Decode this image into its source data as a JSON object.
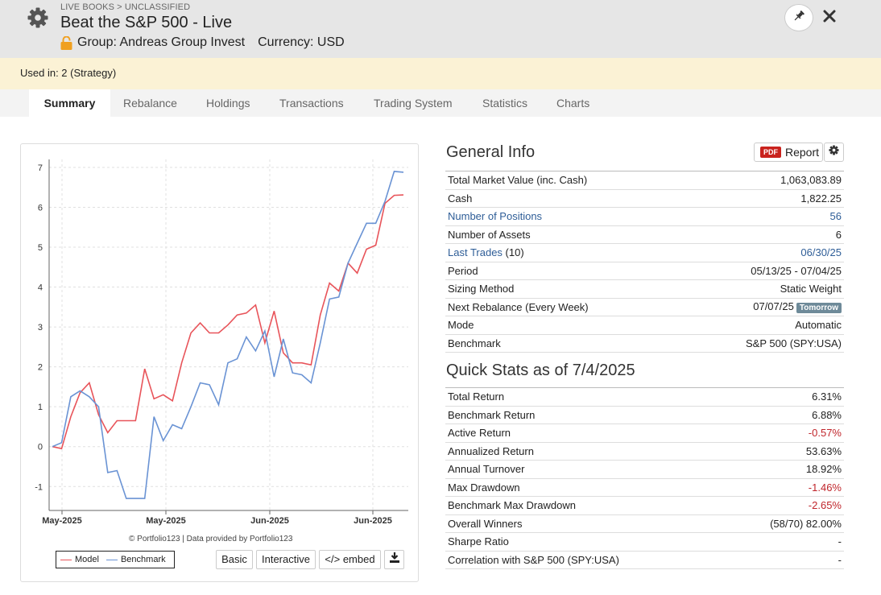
{
  "header": {
    "breadcrumb": "LIVE BOOKS > UNCLASSIFIED",
    "title": "Beat the S&P 500 - Live",
    "group": "Group: Andreas Group Invest",
    "currency": "Currency: USD",
    "settings_icon": "gear-icon",
    "pin_icon": "pin-icon",
    "close_icon": "close-icon"
  },
  "used_in": "Used in: 2 (Strategy)",
  "tabs": [
    {
      "label": "Summary",
      "active": true
    },
    {
      "label": "Rebalance"
    },
    {
      "label": "Holdings"
    },
    {
      "label": "Transactions"
    },
    {
      "label": "Trading System"
    },
    {
      "label": "Statistics"
    },
    {
      "label": "Charts"
    }
  ],
  "colors": {
    "model": "#e8545a",
    "benchmark": "#6a93d4",
    "link": "#2e5d97",
    "negative": "#c0252b"
  },
  "chart": {
    "credit": "© Portfolio123 | Data provided by Portfolio123",
    "buttons": {
      "basic": "Basic",
      "interactive": "Interactive",
      "embed": "</> embed"
    },
    "download_icon": "download-icon"
  },
  "chart_data": {
    "type": "line",
    "xlabel": "",
    "ylabel": "",
    "ylim": [
      -1.6,
      7.2
    ],
    "y_ticks": [
      -1,
      0,
      1,
      2,
      3,
      4,
      5,
      6,
      7
    ],
    "x_tick_labels": [
      "May-2025",
      "May-2025",
      "Jun-2025",
      "Jun-2025"
    ],
    "grid": true,
    "legend_position": "bottom-left",
    "series": [
      {
        "name": "Model",
        "color": "#e8545a",
        "values": [
          0,
          -0.05,
          0.75,
          1.35,
          1.6,
          0.8,
          0.35,
          0.65,
          0.65,
          0.65,
          1.95,
          1.2,
          1.3,
          1.15,
          2.1,
          2.85,
          3.1,
          2.85,
          2.85,
          3.05,
          3.3,
          3.35,
          3.55,
          2.6,
          3.4,
          2.35,
          2.1,
          2.1,
          2.05,
          3.3,
          4.1,
          3.9,
          4.6,
          4.35,
          4.95,
          5.05,
          6.1,
          6.3,
          6.31
        ]
      },
      {
        "name": "Benchmark",
        "color": "#6a93d4",
        "values": [
          0,
          0.1,
          1.25,
          1.4,
          1.25,
          1.0,
          -0.65,
          -0.6,
          -1.3,
          -1.3,
          -1.3,
          0.75,
          0.15,
          0.55,
          0.45,
          1.0,
          1.6,
          1.55,
          1.05,
          2.1,
          2.2,
          2.75,
          2.4,
          2.9,
          1.75,
          2.7,
          1.85,
          1.8,
          1.6,
          2.6,
          3.7,
          3.75,
          4.6,
          5.1,
          5.6,
          5.6,
          6.15,
          6.9,
          6.88
        ]
      }
    ]
  },
  "general_info": {
    "title": "General Info",
    "report_badge": "PDF",
    "report_label": "Report",
    "rows": [
      {
        "label": "Total Market Value (inc. Cash)",
        "value": "1,063,083.89"
      },
      {
        "label": "Cash",
        "value": "1,822.25"
      },
      {
        "label": "Number of Positions",
        "value": "56"
      },
      {
        "label": "Number of Assets",
        "value": "6"
      },
      {
        "label": "Last Trades",
        "label_suffix": " (10)",
        "value": "06/30/25"
      },
      {
        "label": "Period",
        "value": "05/13/25 - 07/04/25"
      },
      {
        "label": "Sizing Method",
        "value": "Static Weight"
      },
      {
        "label": "Next Rebalance (Every Week)",
        "value": "07/07/25",
        "badge": "Tomorrow"
      },
      {
        "label": "Mode",
        "value": "Automatic"
      },
      {
        "label": "Benchmark",
        "value": "S&P 500 (SPY:USA)"
      }
    ]
  },
  "quick_stats": {
    "title": "Quick Stats as of 7/4/2025",
    "rows": [
      {
        "label": "Total Return",
        "value": "6.31%"
      },
      {
        "label": "Benchmark Return",
        "value": "6.88%"
      },
      {
        "label": "Active Return",
        "value": "-0.57%"
      },
      {
        "label": "Annualized Return",
        "value": "53.63%"
      },
      {
        "label": "Annual Turnover",
        "value": "18.92%"
      },
      {
        "label": "Max Drawdown",
        "value": "-1.46%"
      },
      {
        "label": "Benchmark Max Drawdown",
        "value": "-2.65%"
      },
      {
        "label": "Overall Winners",
        "value": "(58/70) 82.00%"
      },
      {
        "label": "Sharpe Ratio",
        "value": "-"
      },
      {
        "label": "Correlation with S&P 500 (SPY:USA)",
        "value": "-"
      }
    ]
  }
}
